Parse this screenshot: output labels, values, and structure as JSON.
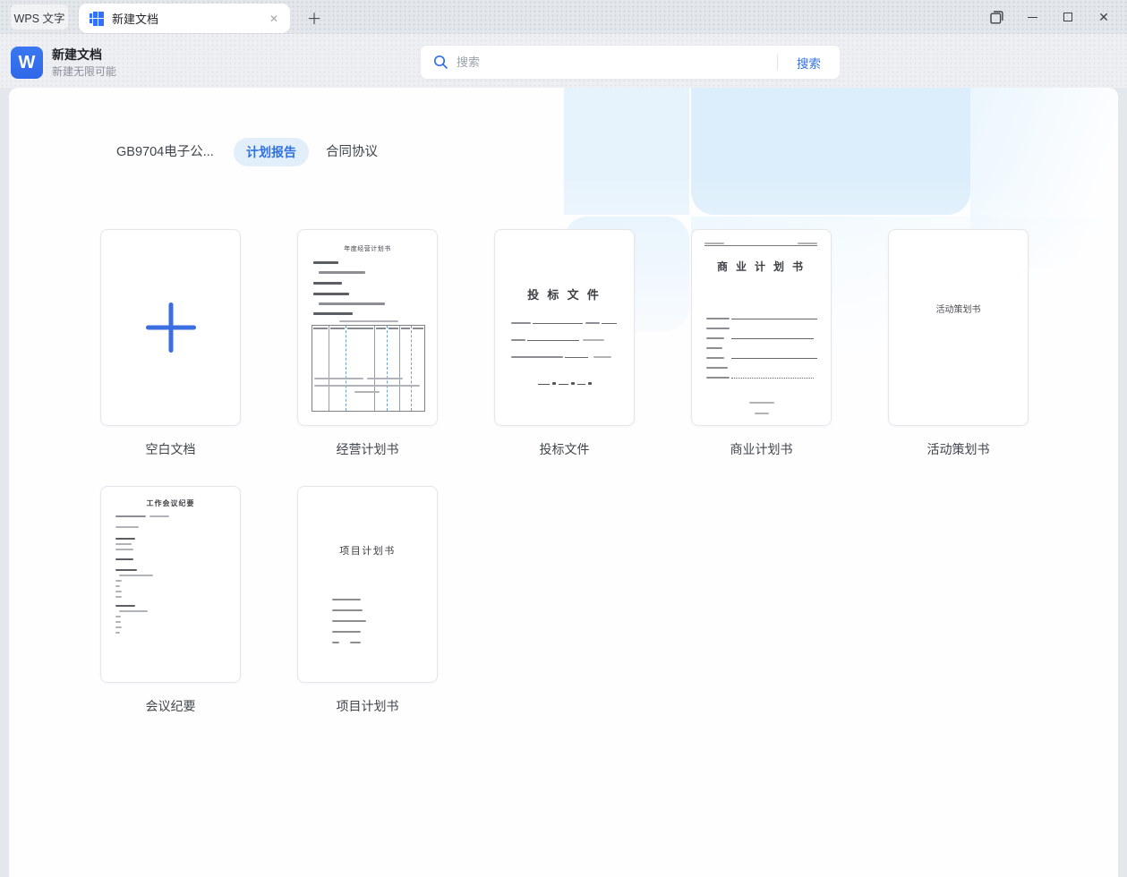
{
  "titlebar": {
    "app_label": "WPS 文字",
    "tab_title": "新建文档",
    "icons": {
      "tab_close": "✕",
      "new_tab": "＋",
      "window_close": "✕"
    }
  },
  "header": {
    "logo_letter": "W",
    "title": "新建文档",
    "subtitle": "新建无限可能",
    "search": {
      "placeholder": "搜索",
      "button_label": "搜索"
    }
  },
  "categories": [
    {
      "label": "GB9704电子公...",
      "active": false
    },
    {
      "label": "计划报告",
      "active": true
    },
    {
      "label": "合同协议",
      "active": false
    }
  ],
  "templates": [
    {
      "label": "空白文档",
      "kind": "blank"
    },
    {
      "label": "经营计划书",
      "kind": "doc-with-table",
      "thumb_title": "年度经营计划书"
    },
    {
      "label": "投标文件",
      "kind": "cover-form",
      "thumb_title": "投 标 文 件"
    },
    {
      "label": "商业计划书",
      "kind": "cover-list",
      "thumb_title": "商 业 计 划 书"
    },
    {
      "label": "活动策划书",
      "kind": "title-only",
      "thumb_title": "活动策划书"
    },
    {
      "label": "会议纪要",
      "kind": "memo",
      "thumb_title": "工作会议纪要"
    },
    {
      "label": "项目计划书",
      "kind": "cover-small-list",
      "thumb_title": "项目计划书"
    }
  ],
  "colors": {
    "accent_blue": "#3370ff",
    "search_button_text": "#3370e4",
    "category_active_bg": "#e2effb",
    "category_active_text": "#3171df",
    "titlebar_bg": "#e3e6ea",
    "header_bg": "#edeff2",
    "panel_bg": "#fefeff",
    "decor_blue": "#dceefb"
  }
}
